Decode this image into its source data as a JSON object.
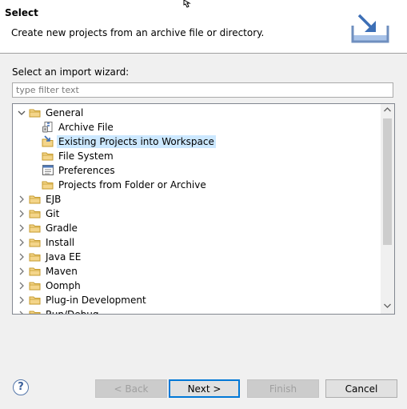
{
  "header": {
    "title": "Select",
    "description": "Create new projects from an archive file or directory.",
    "banner_icon": "import-wizard-icon"
  },
  "wizard": {
    "label": "Select an import wizard:",
    "filter_placeholder": "type filter text"
  },
  "tree": {
    "items": [
      {
        "label": "General",
        "level": 0,
        "expanded": true,
        "has_children": true,
        "icon": "folder-icon"
      },
      {
        "label": "Archive File",
        "level": 1,
        "expanded": false,
        "has_children": false,
        "icon": "archive-file-icon"
      },
      {
        "label": "Existing Projects into Workspace",
        "level": 1,
        "expanded": false,
        "has_children": false,
        "icon": "existing-projects-icon",
        "selected": true
      },
      {
        "label": "File System",
        "level": 1,
        "expanded": false,
        "has_children": false,
        "icon": "folder-icon"
      },
      {
        "label": "Preferences",
        "level": 1,
        "expanded": false,
        "has_children": false,
        "icon": "preferences-icon"
      },
      {
        "label": "Projects from Folder or Archive",
        "level": 1,
        "expanded": false,
        "has_children": false,
        "icon": "folder-icon"
      },
      {
        "label": "EJB",
        "level": 0,
        "expanded": false,
        "has_children": true,
        "icon": "folder-icon"
      },
      {
        "label": "Git",
        "level": 0,
        "expanded": false,
        "has_children": true,
        "icon": "folder-icon"
      },
      {
        "label": "Gradle",
        "level": 0,
        "expanded": false,
        "has_children": true,
        "icon": "folder-icon"
      },
      {
        "label": "Install",
        "level": 0,
        "expanded": false,
        "has_children": true,
        "icon": "folder-icon"
      },
      {
        "label": "Java EE",
        "level": 0,
        "expanded": false,
        "has_children": true,
        "icon": "folder-icon"
      },
      {
        "label": "Maven",
        "level": 0,
        "expanded": false,
        "has_children": true,
        "icon": "folder-icon"
      },
      {
        "label": "Oomph",
        "level": 0,
        "expanded": false,
        "has_children": true,
        "icon": "folder-icon"
      },
      {
        "label": "Plug-in Development",
        "level": 0,
        "expanded": false,
        "has_children": true,
        "icon": "folder-icon"
      },
      {
        "label": "Run/Debug",
        "level": 0,
        "expanded": false,
        "has_children": true,
        "icon": "folder-icon"
      }
    ]
  },
  "buttons": {
    "help": "?",
    "back": "< Back",
    "next": "Next >",
    "finish": "Finish",
    "cancel": "Cancel"
  },
  "colors": {
    "selection": "#cce8ff",
    "folder": "#e8c46a",
    "default_button_border": "#0078d7"
  }
}
